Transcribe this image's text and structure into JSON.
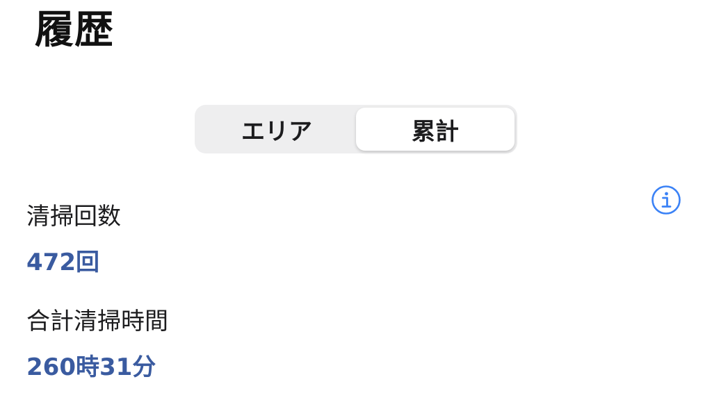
{
  "header": {
    "title": "履歴"
  },
  "segmented_control": {
    "options": [
      {
        "label": "エリア",
        "selected": false
      },
      {
        "label": "累計",
        "selected": true
      }
    ]
  },
  "info": {
    "icon": "info-circle-icon",
    "color": "#3b82f6"
  },
  "stats": {
    "cleaning_count": {
      "label": "清掃回数",
      "value": "472回"
    },
    "total_cleaning_time": {
      "label": "合計清掃時間",
      "value": "260時31分"
    }
  },
  "colors": {
    "value_text": "#3a5ba0",
    "segment_background": "#eeeeef"
  }
}
